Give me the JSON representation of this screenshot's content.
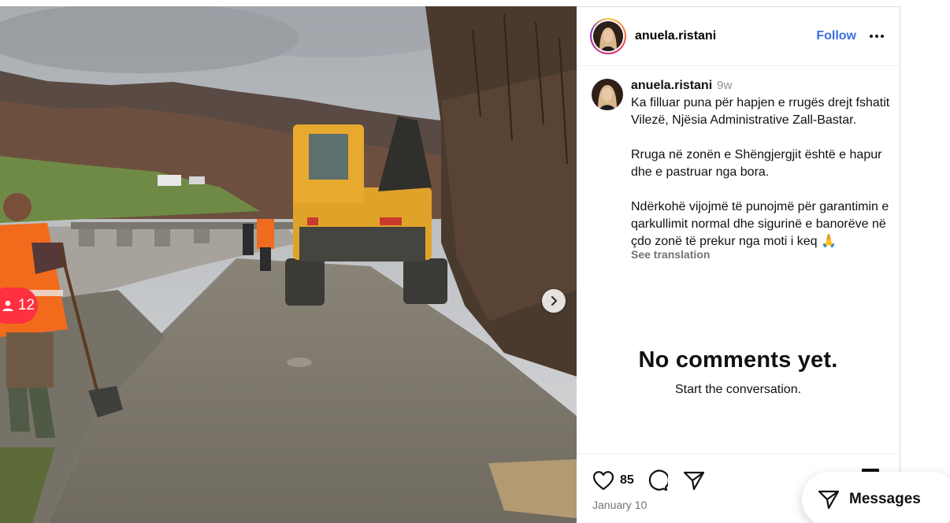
{
  "post": {
    "username": "anuela.ristani",
    "follow_label": "Follow",
    "time_ago": "9w",
    "caption_paragraphs": [
      "Ka filluar puna për hapjen e rrugës drejt fshatit Vilezë, Njësia Administrative Zall-Bastar.",
      "Rruga në zonën e Shëngjergjit është e hapur dhe e pastruar nga bora.",
      "Ndërkohë vijojmë të punojmë për garantimin e qarkullimit normal dhe sigurinë e banorëve në çdo zonë të prekur nga moti i keq 🙏"
    ],
    "see_translation": "See translation",
    "empty_title": "No comments yet.",
    "empty_subtitle": "Start the conversation.",
    "likes": "85",
    "date": "January 10",
    "tagged_count": "12"
  },
  "messages": {
    "label": "Messages"
  },
  "colors": {
    "follow": "#3a6fe0",
    "tag_badge": "#ff3040",
    "muted": "#737373"
  },
  "icons": [
    "more-icon",
    "next-icon",
    "user-tag-icon",
    "heart-icon",
    "comment-icon",
    "share-icon",
    "messages-icon"
  ]
}
